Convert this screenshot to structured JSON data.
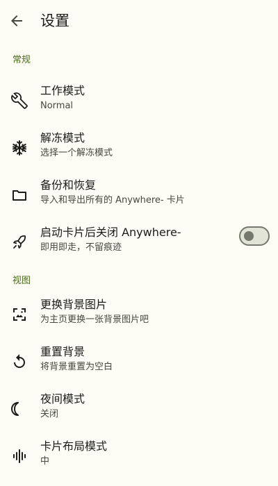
{
  "header": {
    "title": "设置",
    "back_icon": "arrow-back-icon"
  },
  "sections": [
    {
      "label": "常规",
      "items": [
        {
          "title": "工作模式",
          "subtitle": "Normal",
          "icon": "wrench-icon"
        },
        {
          "title": "解冻模式",
          "subtitle": "选择一个解冻模式",
          "icon": "snowflake-icon"
        },
        {
          "title": "备份和恢复",
          "subtitle": "导入和导出所有的 Anywhere- 卡片",
          "icon": "folder-icon"
        },
        {
          "title": "启动卡片后关闭 Anywhere-",
          "subtitle": "即用即走，不留痕迹",
          "icon": "rocket-icon",
          "toggle": false
        }
      ]
    },
    {
      "label": "视图",
      "items": [
        {
          "title": "更换背景图片",
          "subtitle": "为主页更换一张背景图片吧",
          "icon": "wallpaper-icon"
        },
        {
          "title": "重置背景",
          "subtitle": "将背景重置为空白",
          "icon": "reset-icon"
        },
        {
          "title": "夜间模式",
          "subtitle": "关闭",
          "icon": "moon-icon"
        },
        {
          "title": "卡片布局模式",
          "subtitle": "中",
          "icon": "layout-icon"
        }
      ]
    }
  ],
  "colors": {
    "background": "#fdfcf5",
    "accent": "#4a6a1a",
    "text": "#1c1c18",
    "secondary_text": "#45483e"
  }
}
